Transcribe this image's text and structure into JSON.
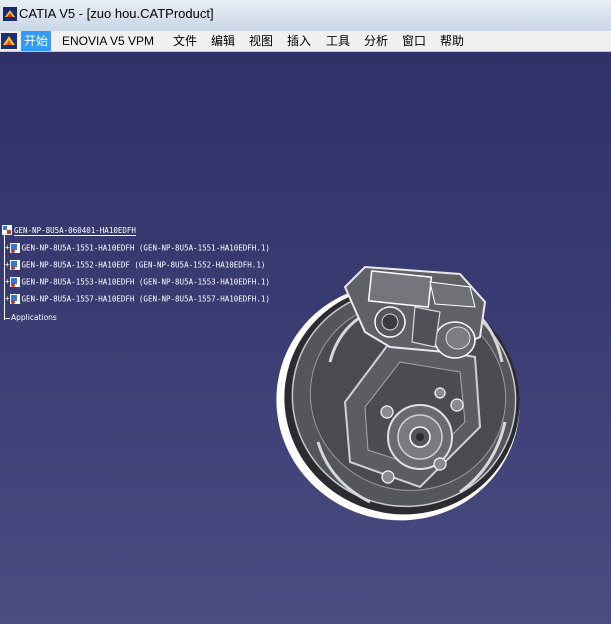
{
  "window": {
    "title": "CATIA V5 - [zuo hou.CATProduct]",
    "app_icon": "catia-logo-icon"
  },
  "menubar": {
    "doc_icon": "catia-document-icon",
    "items": [
      "开始",
      "ENOVIA V5 VPM",
      "文件",
      "编辑",
      "视图",
      "插入",
      "工具",
      "分析",
      "窗口",
      "帮助"
    ],
    "active_index": 0
  },
  "tree": {
    "root": "GEN-NP-8U5A-060401-HA10EDFH",
    "children": [
      "GEN-NP-8U5A-1551-HA10EDFH (GEN-NP-8U5A-1551-HA10EDFH.1)",
      "GEN-NP-8U5A-1552-HA10EDF (GEN-NP-8U5A-1552-HA10EDFH.1)",
      "GEN-NP-8U5A-1553-HA10EDFH (GEN-NP-8U5A-1553-HA10EDFH.1)",
      "GEN-NP-8U5A-1557-HA10EDFH (GEN-NP-8U5A-1557-HA10EDFH.1)"
    ],
    "applications": "Applications"
  },
  "colors": {
    "viewport_top": "#2f3168",
    "viewport_bottom": "#4a4c82",
    "menu_active": "#3399ff"
  }
}
